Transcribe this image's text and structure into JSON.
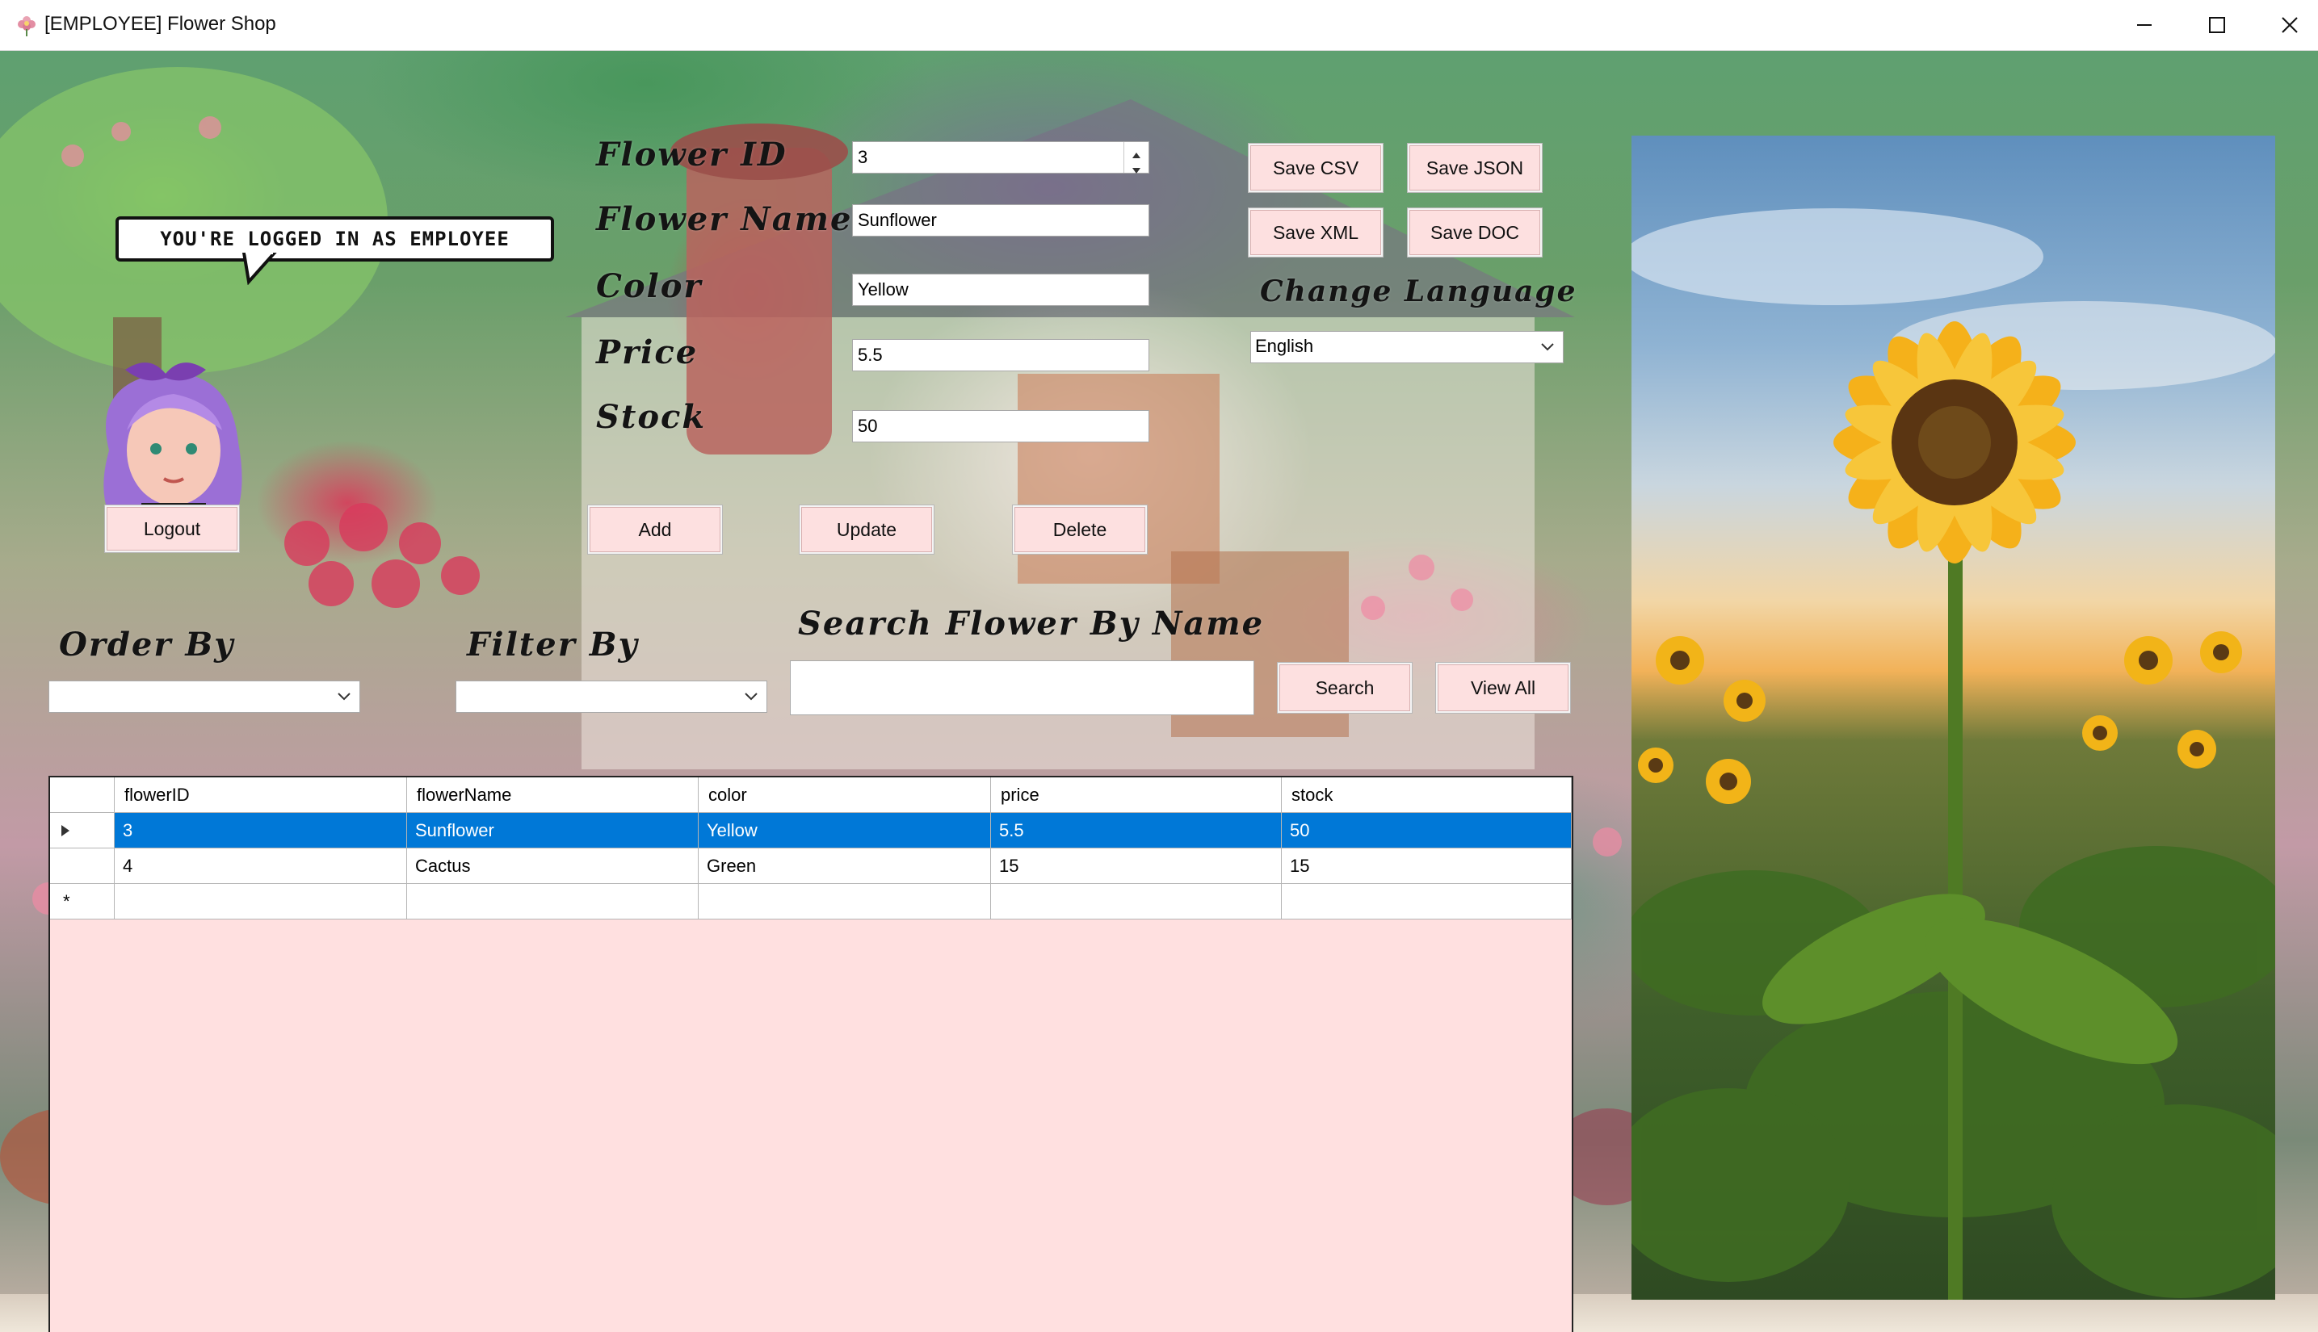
{
  "window": {
    "title": "[EMPLOYEE] Flower Shop",
    "minimize_icon": "minimize-icon",
    "maximize_icon": "maximize-icon",
    "close_icon": "close-icon"
  },
  "status": {
    "logged_in_text": "YOU'RE LOGGED IN AS EMPLOYEE"
  },
  "form": {
    "flower_id_label": "Flower ID",
    "flower_id_value": "3",
    "flower_name_label": "Flower Name",
    "flower_name_value": "Sunflower",
    "color_label": "Color",
    "color_value": "Yellow",
    "price_label": "Price",
    "price_value": "5.5",
    "stock_label": "Stock",
    "stock_value": "50"
  },
  "buttons": {
    "logout": "Logout",
    "add": "Add",
    "update": "Update",
    "delete": "Delete",
    "save_csv": "Save CSV",
    "save_json": "Save JSON",
    "save_xml": "Save XML",
    "save_doc": "Save DOC",
    "search": "Search",
    "view_all": "View All"
  },
  "language": {
    "label": "Change Language",
    "selected": "English"
  },
  "filters": {
    "order_by_label": "Order By",
    "order_by_value": "",
    "filter_by_label": "Filter By",
    "filter_by_value": "",
    "search_label": "Search Flower By Name",
    "search_value": ""
  },
  "grid": {
    "columns": [
      "flowerID",
      "flowerName",
      "color",
      "price",
      "stock"
    ],
    "rows": [
      [
        "3",
        "Sunflower",
        "Yellow",
        "5.5",
        "50"
      ],
      [
        "4",
        "Cactus",
        "Green",
        "15",
        "15"
      ]
    ],
    "selected_row": 0,
    "new_row_marker": "*"
  },
  "colors": {
    "button_bg": "#fde0e0",
    "grid_bg": "#ffe0e0",
    "selection": "#0078d7"
  }
}
